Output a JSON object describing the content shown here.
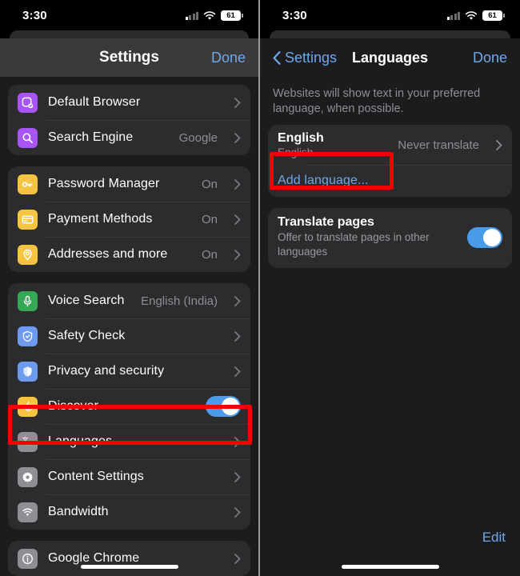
{
  "status_bar": {
    "time": "3:30",
    "battery": "61",
    "wifi_icon": "wifi-icon",
    "signal_icon": "cellular-signal-icon"
  },
  "left_screen": {
    "nav": {
      "title": "Settings",
      "done_label": "Done"
    },
    "groups": [
      {
        "rows": [
          {
            "label": "Default Browser",
            "value": "",
            "icon": "default-browser-icon",
            "icon_color": "#a855f7",
            "accessory": "chevron"
          },
          {
            "label": "Search Engine",
            "value": "Google",
            "icon": "search-icon",
            "icon_color": "#a855f7",
            "accessory": "chevron"
          }
        ]
      },
      {
        "rows": [
          {
            "label": "Password Manager",
            "value": "On",
            "icon": "key-icon",
            "icon_color": "#f5c542",
            "accessory": "chevron"
          },
          {
            "label": "Payment Methods",
            "value": "On",
            "icon": "credit-card-icon",
            "icon_color": "#f5c542",
            "accessory": "chevron"
          },
          {
            "label": "Addresses and more",
            "value": "On",
            "icon": "location-pin-icon",
            "icon_color": "#f5c542",
            "accessory": "chevron"
          }
        ]
      },
      {
        "rows": [
          {
            "label": "Voice Search",
            "value": "English (India)",
            "icon": "microphone-icon",
            "icon_color": "#34a853",
            "accessory": "chevron"
          },
          {
            "label": "Safety Check",
            "value": "",
            "icon": "shield-check-icon",
            "icon_color": "#6e9bf0",
            "accessory": "chevron"
          },
          {
            "label": "Privacy and security",
            "value": "",
            "icon": "shield-lock-icon",
            "icon_color": "#6e9bf0",
            "accessory": "chevron"
          },
          {
            "label": "Discover",
            "value": "",
            "icon": "discover-flame-icon",
            "icon_color": "#f5c542",
            "accessory": "toggle",
            "toggle_on": true
          },
          {
            "label": "Languages",
            "value": "",
            "icon": "translate-icon",
            "icon_color": "#8e8e93",
            "accessory": "chevron",
            "highlighted": true
          },
          {
            "label": "Content Settings",
            "value": "",
            "icon": "gear-icon",
            "icon_color": "#8e8e93",
            "accessory": "chevron"
          },
          {
            "label": "Bandwidth",
            "value": "",
            "icon": "bandwidth-wifi-icon",
            "icon_color": "#8e8e93",
            "accessory": "chevron"
          }
        ]
      },
      {
        "rows": [
          {
            "label": "Google Chrome",
            "value": "",
            "icon": "info-icon",
            "icon_color": "#8e8e93",
            "accessory": "chevron"
          }
        ]
      }
    ]
  },
  "right_screen": {
    "nav": {
      "back_label": "Settings",
      "title": "Languages",
      "done_label": "Done"
    },
    "footnote": "Websites will show text in your preferred language, when possible.",
    "language_row": {
      "title": "English",
      "subtitle": "English",
      "value": "Never translate"
    },
    "add_language_label": "Add language...",
    "translate_pages": {
      "title": "Translate pages",
      "subtitle": "Offer to translate pages in other languages",
      "toggle_on": true
    },
    "edit_label": "Edit"
  },
  "annotations": {
    "accent_red": "#f50000",
    "boxes": [
      {
        "name": "languages-row-highlight"
      },
      {
        "name": "add-language-highlight"
      }
    ]
  }
}
